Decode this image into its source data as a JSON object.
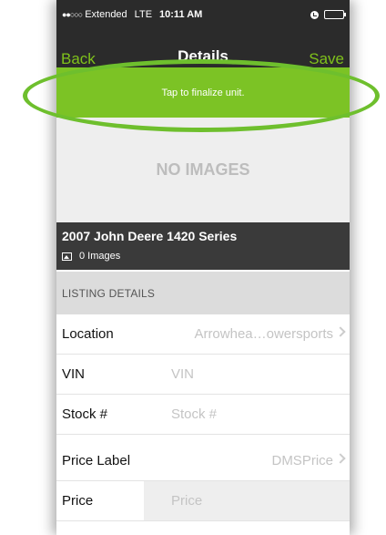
{
  "status_bar": {
    "signal": "●●○○○",
    "carrier": "Extended",
    "network": "LTE",
    "time": "10:11 AM",
    "icons": [
      "alarm-icon",
      "battery-icon"
    ]
  },
  "nav": {
    "back_label": "Back",
    "title": "Details",
    "save_label": "Save"
  },
  "banner": {
    "text": "Tap to finalize unit.",
    "color": "#7cc325"
  },
  "gallery": {
    "placeholder": "NO IMAGES"
  },
  "unit": {
    "title": "2007 John Deere 1420 Series",
    "image_count": "0 Images",
    "icon": "image-icon"
  },
  "section": {
    "header": "LISTING DETAILS"
  },
  "fields": {
    "location": {
      "label": "Location",
      "value": "Arrowhea…owersports"
    },
    "vin": {
      "label": "VIN",
      "placeholder": "VIN"
    },
    "stock": {
      "label": "Stock #",
      "placeholder": "Stock #"
    },
    "price_label": {
      "label": "Price Label",
      "value": "DMSPrice"
    },
    "price": {
      "label": "Price",
      "placeholder": "Price"
    }
  },
  "colors": {
    "accent": "#7fc21b",
    "bar_background": "#2b2b2b",
    "highlight_ring": "#6ebf2d"
  }
}
